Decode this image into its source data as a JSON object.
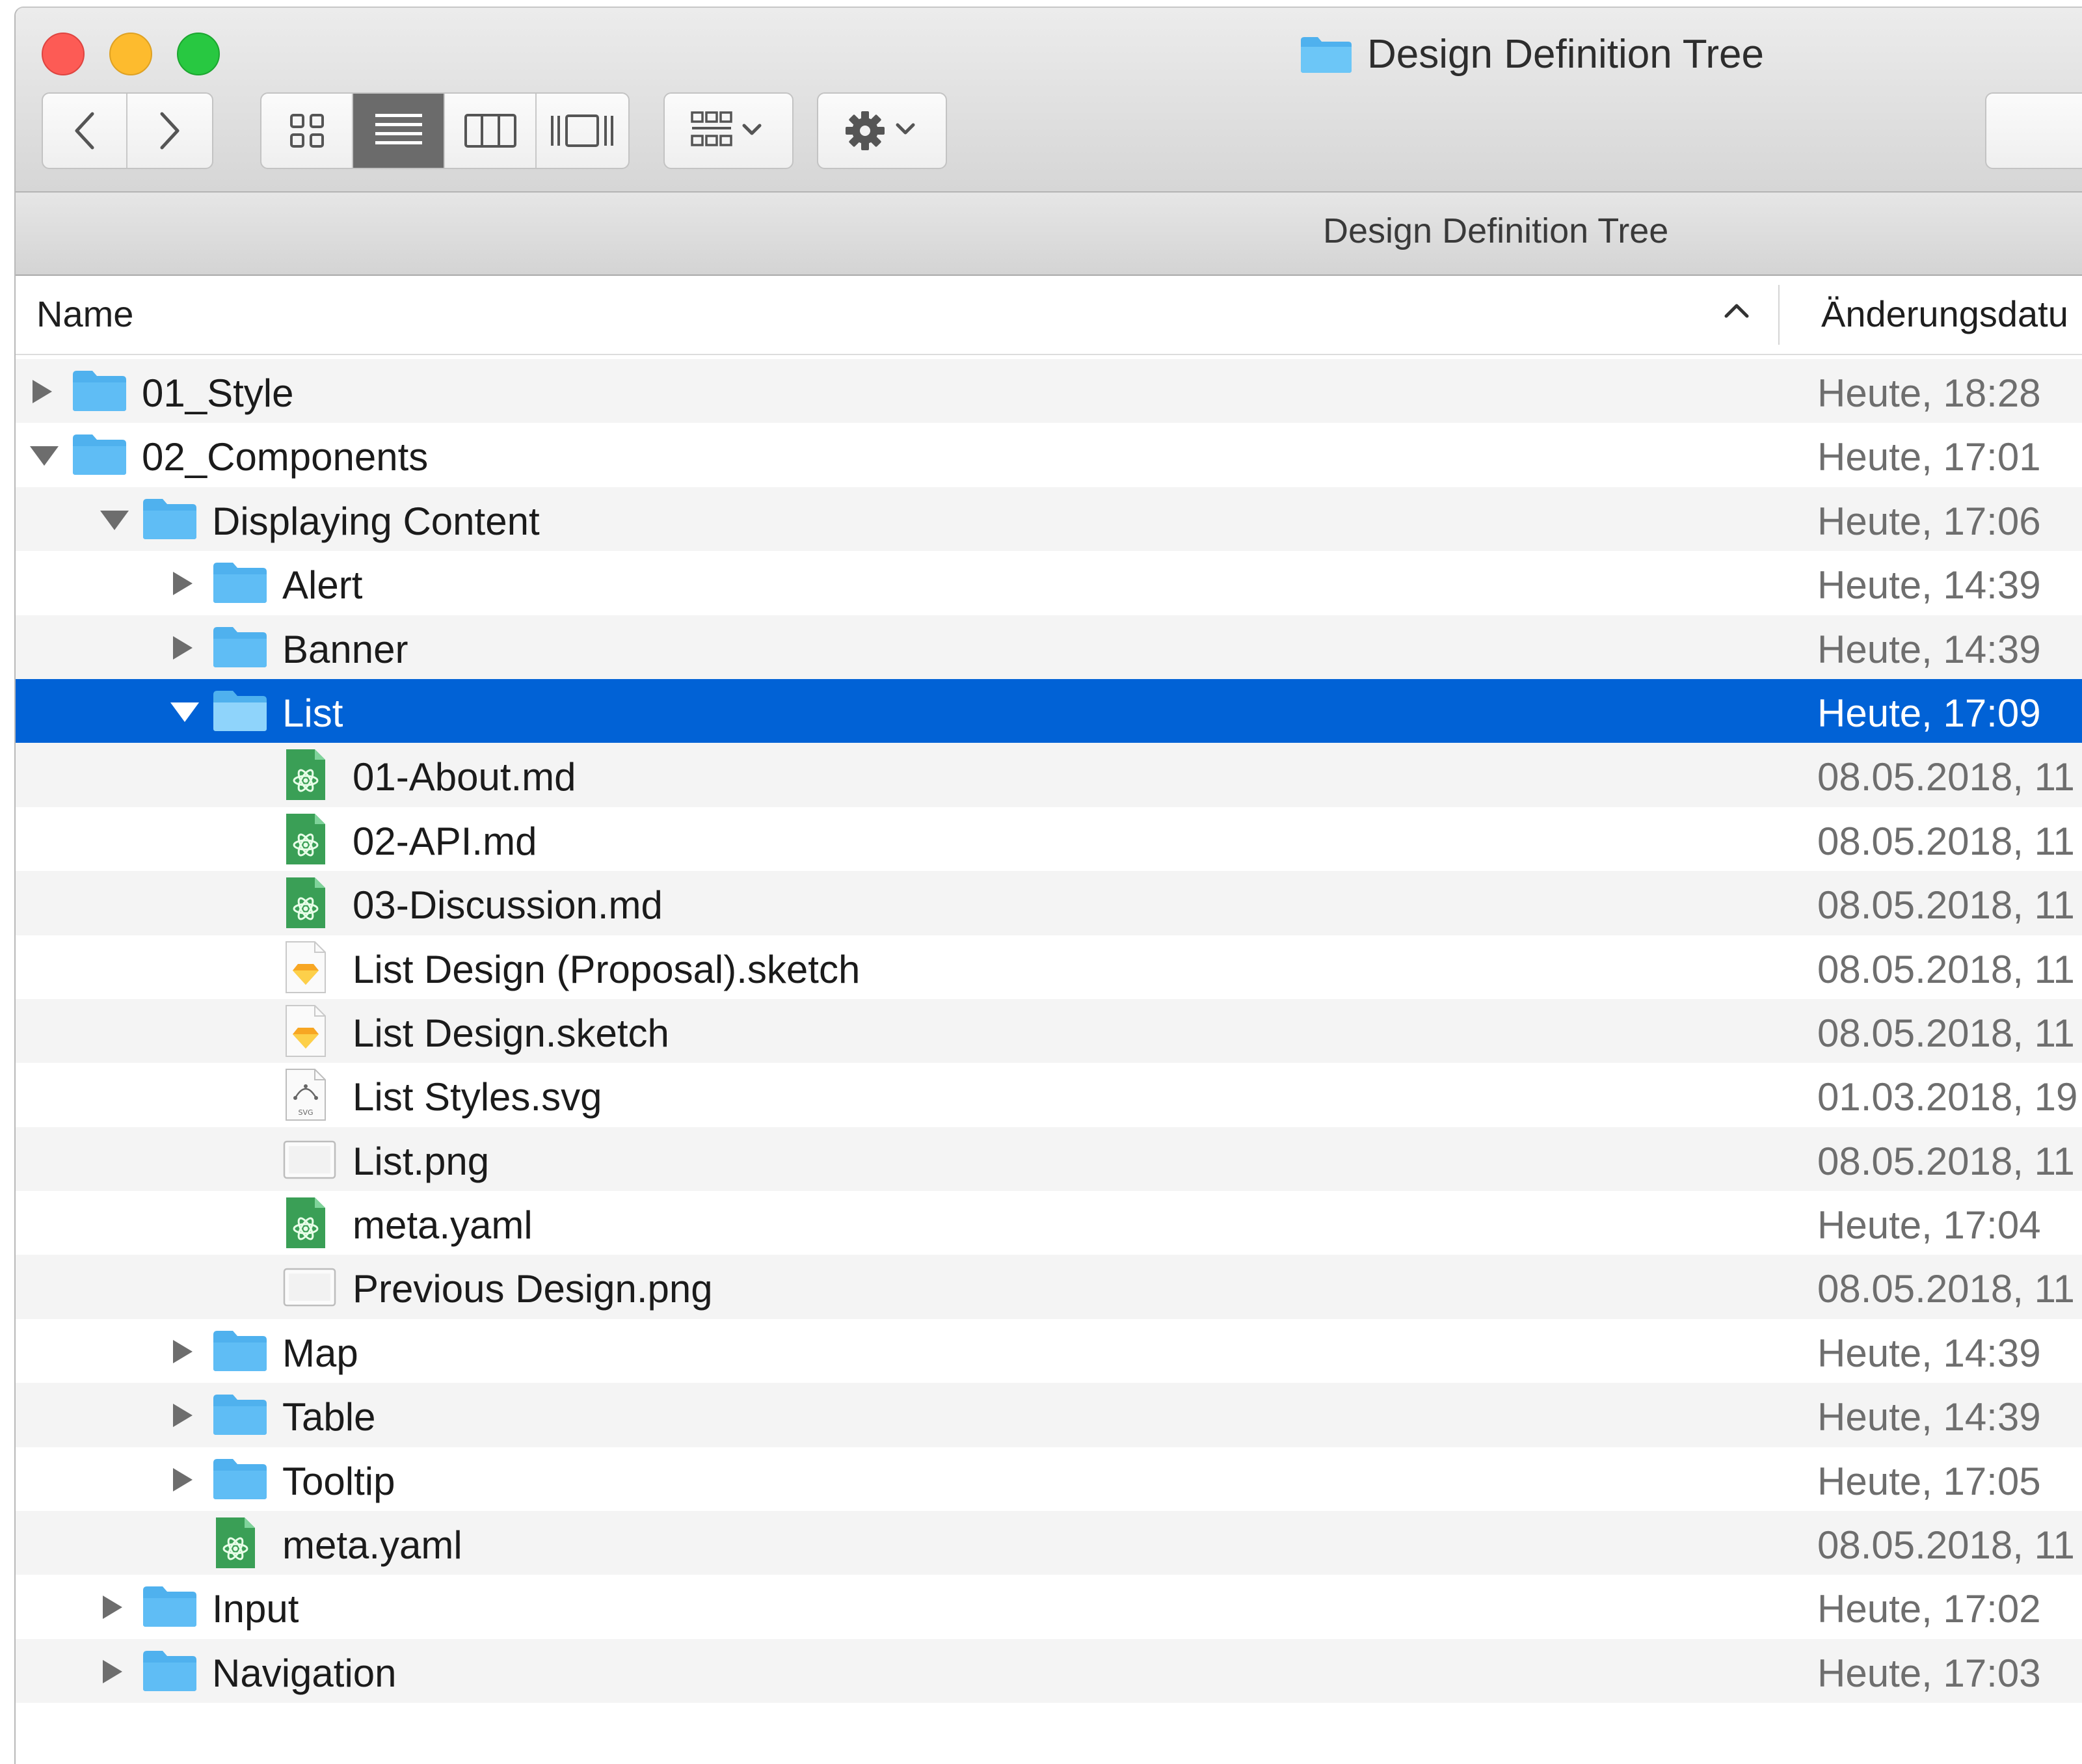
{
  "window": {
    "title": "Design Definition Tree"
  },
  "toolbar": {
    "back_icon": "chevron-left-icon",
    "forward_icon": "chevron-right-icon",
    "view_modes": [
      "icon-view-icon",
      "list-view-icon",
      "column-view-icon",
      "cover-flow-icon"
    ],
    "active_view": "list-view-icon",
    "group_icon": "group-by-icon",
    "action_icon": "gear-icon"
  },
  "pathbar": {
    "label": "Design Definition Tree"
  },
  "columns": {
    "name": "Name",
    "date": "Änderungsdatu",
    "sort": "ascending"
  },
  "colors": {
    "selection": "#0162d6",
    "folder": "#5fbdf5",
    "atom": "#3a9f56",
    "sketch": "#f7a623"
  },
  "rows": [
    {
      "name": "01_Style",
      "date": "Heute, 18:28",
      "level": 0,
      "kind": "folder",
      "disclosure": "collapsed"
    },
    {
      "name": "02_Components",
      "date": "Heute, 17:01",
      "level": 0,
      "kind": "folder",
      "disclosure": "expanded"
    },
    {
      "name": "Displaying Content",
      "date": "Heute, 17:06",
      "level": 1,
      "kind": "folder",
      "disclosure": "expanded"
    },
    {
      "name": "Alert",
      "date": "Heute, 14:39",
      "level": 2,
      "kind": "folder",
      "disclosure": "collapsed"
    },
    {
      "name": "Banner",
      "date": "Heute, 14:39",
      "level": 2,
      "kind": "folder",
      "disclosure": "collapsed"
    },
    {
      "name": "List",
      "date": "Heute, 17:09",
      "level": 2,
      "kind": "folder",
      "disclosure": "expanded",
      "selected": true
    },
    {
      "name": "01-About.md",
      "date": "08.05.2018, 11",
      "level": 3,
      "kind": "atom",
      "disclosure": "none"
    },
    {
      "name": "02-API.md",
      "date": "08.05.2018, 11",
      "level": 3,
      "kind": "atom",
      "disclosure": "none"
    },
    {
      "name": "03-Discussion.md",
      "date": "08.05.2018, 11",
      "level": 3,
      "kind": "atom",
      "disclosure": "none"
    },
    {
      "name": "List Design (Proposal).sketch",
      "date": "08.05.2018, 11",
      "level": 3,
      "kind": "sketch",
      "disclosure": "none"
    },
    {
      "name": "List Design.sketch",
      "date": "08.05.2018, 11",
      "level": 3,
      "kind": "sketch",
      "disclosure": "none"
    },
    {
      "name": "List Styles.svg",
      "date": "01.03.2018, 19",
      "level": 3,
      "kind": "svg",
      "disclosure": "none"
    },
    {
      "name": "List.png",
      "date": "08.05.2018, 11",
      "level": 3,
      "kind": "png",
      "disclosure": "none"
    },
    {
      "name": "meta.yaml",
      "date": "Heute, 17:04",
      "level": 3,
      "kind": "atom",
      "disclosure": "none"
    },
    {
      "name": "Previous Design.png",
      "date": "08.05.2018, 11",
      "level": 3,
      "kind": "png",
      "disclosure": "none"
    },
    {
      "name": "Map",
      "date": "Heute, 14:39",
      "level": 2,
      "kind": "folder",
      "disclosure": "collapsed"
    },
    {
      "name": "Table",
      "date": "Heute, 14:39",
      "level": 2,
      "kind": "folder",
      "disclosure": "collapsed"
    },
    {
      "name": "Tooltip",
      "date": "Heute, 17:05",
      "level": 2,
      "kind": "folder",
      "disclosure": "collapsed"
    },
    {
      "name": "meta.yaml",
      "date": "08.05.2018, 11",
      "level": 2,
      "kind": "atom",
      "disclosure": "none"
    },
    {
      "name": "Input",
      "date": "Heute, 17:02",
      "level": 1,
      "kind": "folder",
      "disclosure": "collapsed"
    },
    {
      "name": "Navigation",
      "date": "Heute, 17:03",
      "level": 1,
      "kind": "folder",
      "disclosure": "collapsed"
    }
  ]
}
